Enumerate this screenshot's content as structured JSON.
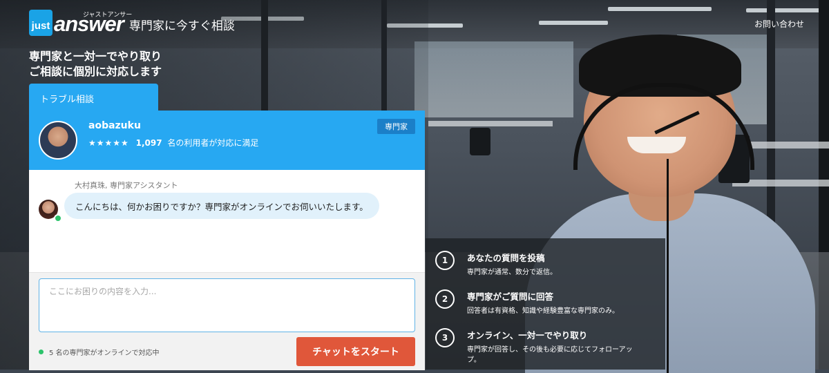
{
  "header": {
    "logo_just": "just",
    "logo_answer": "answer",
    "logo_katakana": "ジャストアンサー",
    "tagline": "専門家に今すぐ相談",
    "contact_link": "お問い合わせ"
  },
  "headline": {
    "line1": "専門家と一対一でやり取り",
    "line2": "ご相談に個別に対応します"
  },
  "chat": {
    "tab_label": "トラブル相談",
    "expert": {
      "name": "aobazuku",
      "stars": "★★★★★",
      "satisfied_count": "1,097",
      "satisfied_text": "名の利用者が対応に満足",
      "badge": "専門家"
    },
    "assistant_name": "大村真珠, 専門家アシスタント",
    "message": "こんにちは、何かお困りですか？専門家がオンラインでお伺いいたします。",
    "input_placeholder": "ここにお困りの内容を入力...",
    "online_status": "5 名の専門家がオンラインで対応中",
    "start_button": "チャットをスタート"
  },
  "steps": [
    {
      "number": "1",
      "title": "あなたの質問を投稿",
      "desc": "専門家が通常、数分で返信。"
    },
    {
      "number": "2",
      "title": "専門家がご質問に回答",
      "desc": "回答者は有資格、知識や経験豊富な専門家のみ。"
    },
    {
      "number": "3",
      "title": "オンライン、一対一でやり取り",
      "desc": "専門家が回答し、その後も必要に応じてフォローアッ プ。"
    }
  ],
  "colors": {
    "accent_blue": "#27a8f2",
    "cta_orange": "#e0573a",
    "online_green": "#2cc36b"
  }
}
